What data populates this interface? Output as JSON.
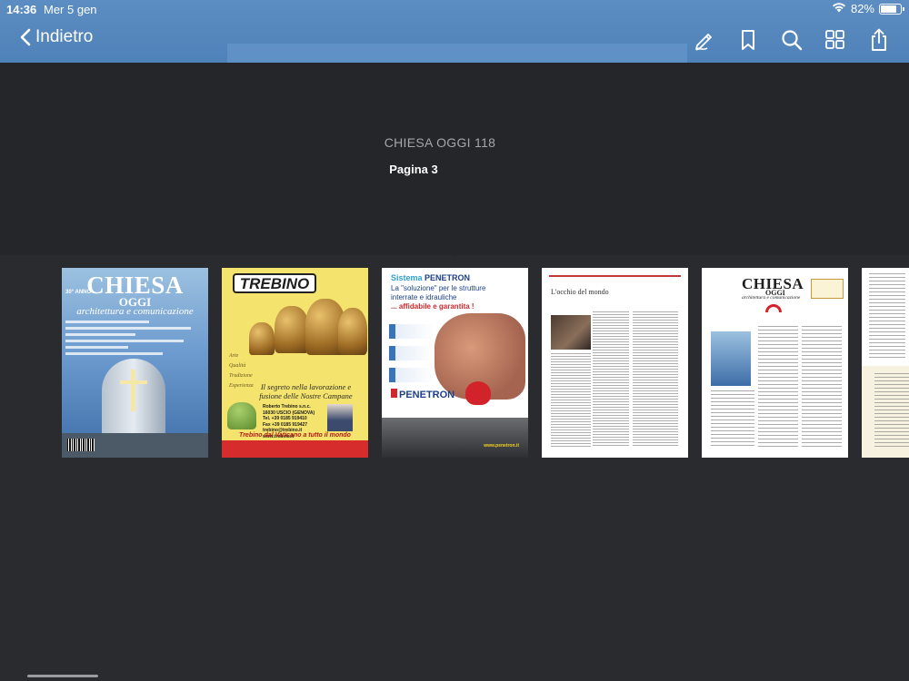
{
  "status": {
    "time": "14:36",
    "date": "Mer 5 gen",
    "battery": "82%",
    "battery_level": 0.82
  },
  "nav": {
    "back_label": "Indietro",
    "icons": [
      "markup-pen-icon",
      "bookmark-icon",
      "search-icon",
      "grid-thumbnails-icon",
      "share-icon"
    ]
  },
  "document": {
    "title": "CHIESA OGGI 118",
    "page_label": "Pagina 3"
  },
  "thumbnails": {
    "cover1": {
      "masthead": "CHIESA",
      "masthead2": "OGGI",
      "subtitle": "architettura e comunicazione",
      "tag": "30° ANNO"
    },
    "cover2": {
      "logo": "TREBINO",
      "script": "Arte\nQualità\nTradizione\nEsperienza",
      "slogan": "Il segreto nella lavorazione e fusione delle Nostre Campane",
      "address": "Roberto Trebino s.n.c.\n16030 USCIO (GENOVA)\nTel. +39 0185 919410\nFax +39 0185 919427\ntrebino@trebino.it\nwww.trebino.it",
      "motto": "Trebino dal Vaticano a tutto il mondo"
    },
    "cover3": {
      "brand_prefix": "Sistema",
      "brand": "PENETRON",
      "headline_a": "La \"soluzione\" per le strutture interrate e idrauliche",
      "headline_b": "... affidabile e garantita !",
      "logo": "PENETRON",
      "url": "www.penetron.it"
    },
    "page4": {
      "title": "L'occhio del mondo"
    },
    "page5": {
      "masthead": "CHIESA",
      "masthead2": "OGGI",
      "subtitle": "architettura e comunicazione"
    }
  }
}
